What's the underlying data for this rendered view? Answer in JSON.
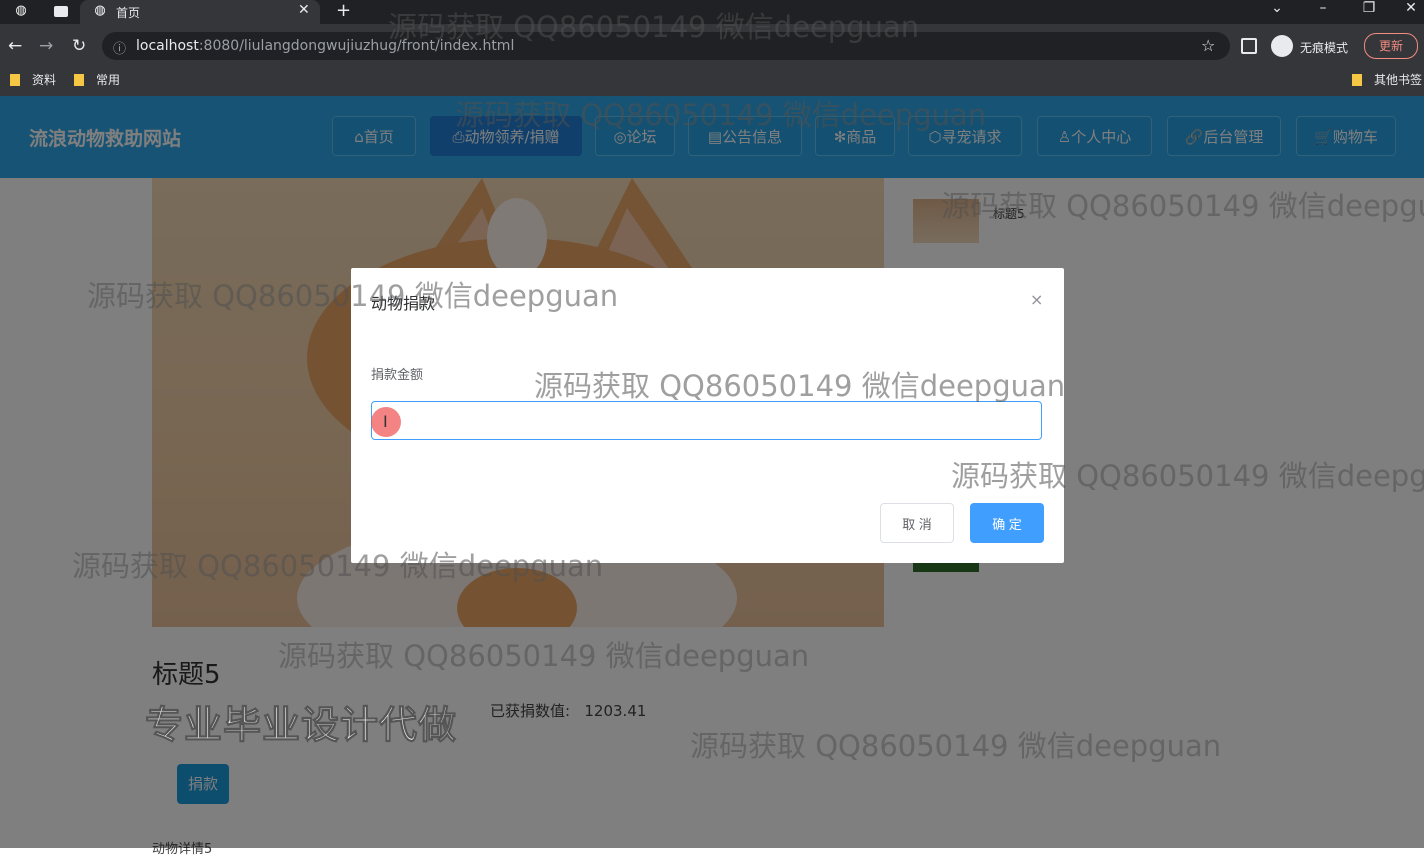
{
  "browser": {
    "tab_title": "首页",
    "url_host": "localhost",
    "url_rest": ":8080/liulangdongwujiuzhug/front/index.html",
    "incognito_label": "无痕模式",
    "update_label": "更新",
    "bookmarks": [
      "资料",
      "常用"
    ],
    "other_bookmarks": "其他书签"
  },
  "site": {
    "title": "流浪动物救助网站",
    "nav": [
      {
        "label": "⌂首页"
      },
      {
        "label": "⎙动物领养/捐赠"
      },
      {
        "label": "◎论坛"
      },
      {
        "label": "▤公告信息"
      },
      {
        "label": "✻商品"
      },
      {
        "label": "⬡寻宠请求"
      },
      {
        "label": "♙个人中心"
      },
      {
        "label": "🔗后台管理"
      },
      {
        "label": "🛒购物车"
      }
    ]
  },
  "content": {
    "thumb_label": "标题5",
    "detail_title": "标题5",
    "raised_label": "已获捐数值:",
    "raised_value": "1203.41",
    "donate_button": "捐款",
    "bottom_text": "动物详情5",
    "brand_mark": "专业毕业设计代做"
  },
  "modal": {
    "title": "动物捐款",
    "close": "×",
    "field_label": "捐款金额",
    "input_value": "",
    "cancel": "取 消",
    "confirm": "确 定"
  },
  "watermark": "源码获取 QQ86050149 微信deepguan"
}
